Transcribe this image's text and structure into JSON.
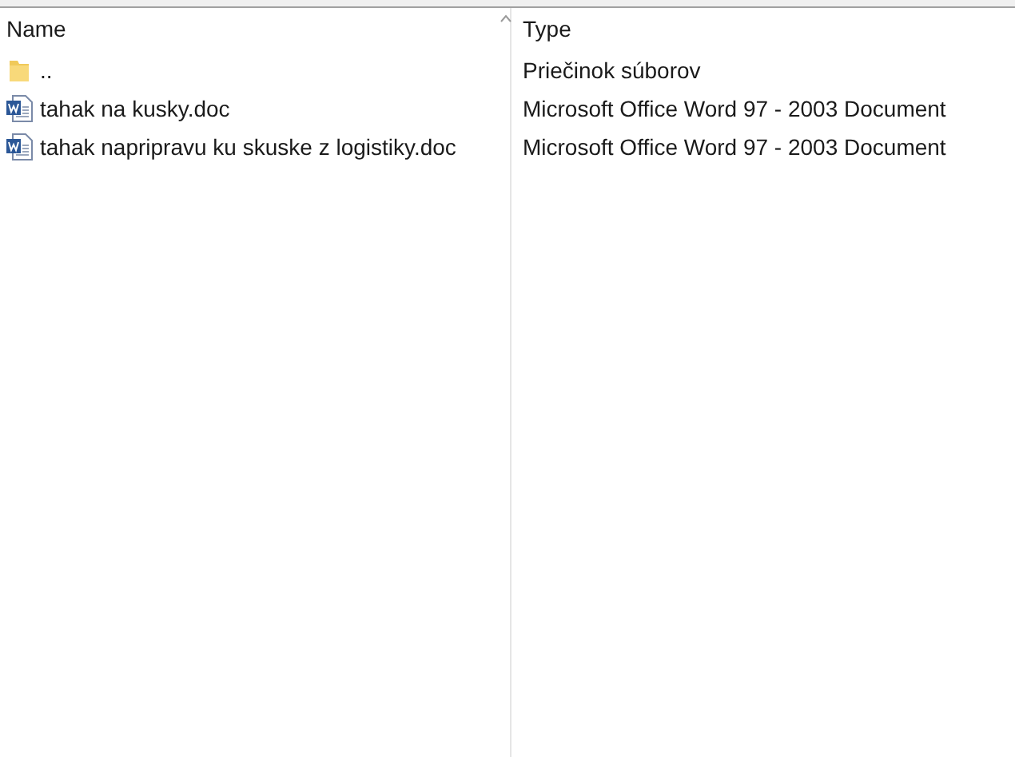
{
  "columns": [
    {
      "label": "Name",
      "sorted": true
    },
    {
      "label": "Type",
      "sorted": false
    }
  ],
  "rows": [
    {
      "kind": "folder",
      "name": "..",
      "type": "Priečinok súborov"
    },
    {
      "kind": "document",
      "name": "tahak na kusky.doc",
      "type": "Microsoft Office Word 97 - 2003 Document"
    },
    {
      "kind": "document",
      "name": "tahak napripravu ku skuske z logistiky.doc",
      "type": "Microsoft Office Word 97 - 2003 Document"
    }
  ]
}
